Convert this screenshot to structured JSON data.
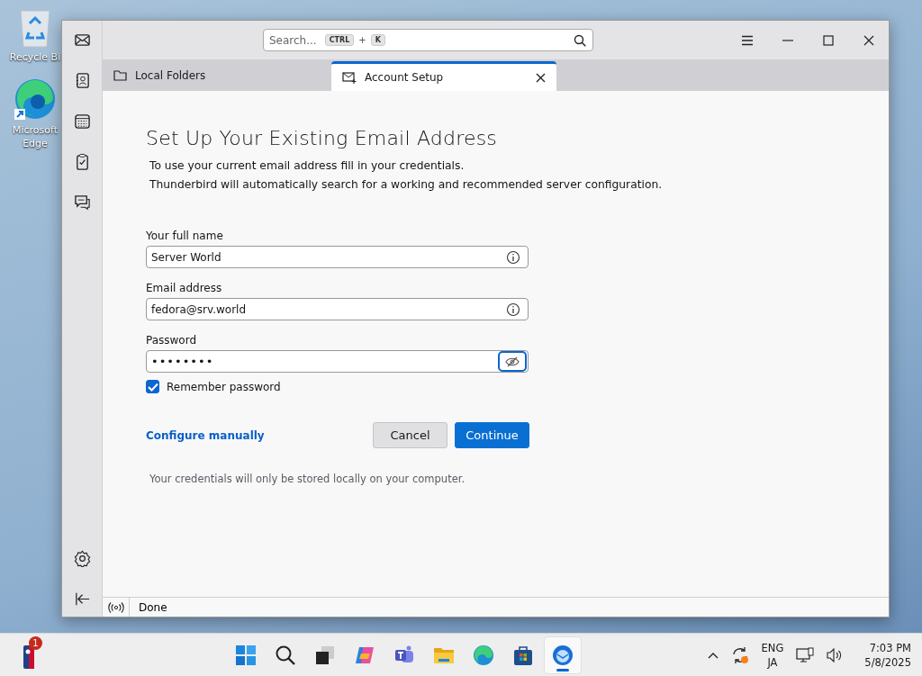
{
  "desktop_icons": [
    {
      "label": "Recycle Bi",
      "kind": "bin"
    },
    {
      "label": "Microsoft Edge",
      "kind": "edge"
    }
  ],
  "search": {
    "placeholder": "Search...",
    "keys": [
      "CTRL",
      "+",
      "K"
    ]
  },
  "tabs": [
    {
      "label": "Local Folders",
      "kind": "folder",
      "selected": false
    },
    {
      "label": "Account Setup",
      "kind": "setup",
      "selected": true
    }
  ],
  "form": {
    "title": "Set Up Your Existing Email Address",
    "intro": [
      "To use your current email address fill in your credentials.",
      "Thunderbird will automatically search for a working and recommended server configuration."
    ],
    "fields": [
      {
        "label": "Your full name",
        "value": "Server World",
        "kind": "text"
      },
      {
        "label": "Email address",
        "value": "fedora@srv.world",
        "kind": "text"
      },
      {
        "label": "Password",
        "value": "••••••••",
        "kind": "password"
      }
    ],
    "remember": {
      "label": "Remember password",
      "checked": true
    },
    "link": "Configure manually",
    "buttons": [
      {
        "label": "Cancel",
        "kind": "secondary"
      },
      {
        "label": "Continue",
        "kind": "primary"
      }
    ],
    "note": "Your credentials will only be stored locally on your computer."
  },
  "status_bar": {
    "text": "Done"
  },
  "taskbar": {
    "badge": "1",
    "apps": [
      {
        "kind": "start",
        "selected": false
      },
      {
        "kind": "search",
        "selected": false
      },
      {
        "kind": "taskview",
        "selected": false
      },
      {
        "kind": "copilot",
        "selected": false
      },
      {
        "kind": "teams",
        "selected": false
      },
      {
        "kind": "files",
        "selected": false
      },
      {
        "kind": "edge",
        "selected": false
      },
      {
        "kind": "store",
        "selected": false
      },
      {
        "kind": "thunderbird",
        "selected": true
      }
    ],
    "language": [
      "ENG",
      "JA"
    ],
    "time": "7:03 PM",
    "date": "5/8/2025"
  }
}
